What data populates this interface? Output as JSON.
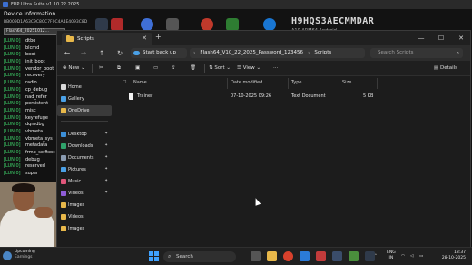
{
  "bgapp": {
    "title": "FRP Ultra Suite v1.10.22.2025",
    "header": "Device Information",
    "serial_label": "BB009D1A63C9C8CC7F0C4A4E4093C8D",
    "serial_value": "Flash64_20251012...",
    "device_name": "H9HQS3AECMMDAR",
    "device_sub": "A10 ARM64 Android",
    "partitions": [
      {
        "tag": "[LUN 0]",
        "name": "dtbo"
      },
      {
        "tag": "[LUN 0]",
        "name": "blcmd"
      },
      {
        "tag": "[LUN 0]",
        "name": "boot"
      },
      {
        "tag": "[LUN 0]",
        "name": "init_boot"
      },
      {
        "tag": "[LUN 0]",
        "name": "vendor_boot"
      },
      {
        "tag": "[LUN 0]",
        "name": "recovery"
      },
      {
        "tag": "[LUN 0]",
        "name": "radio"
      },
      {
        "tag": "[LUN 0]",
        "name": "cp_debug"
      },
      {
        "tag": "[LUN 0]",
        "name": "nad_refer"
      },
      {
        "tag": "[LUN 0]",
        "name": "persistent"
      },
      {
        "tag": "[LUN 0]",
        "name": "misc"
      },
      {
        "tag": "[LUN 0]",
        "name": "keyrefuge"
      },
      {
        "tag": "[LUN 0]",
        "name": "dqmdbg"
      },
      {
        "tag": "[LUN 0]",
        "name": "vbmeta"
      },
      {
        "tag": "[LUN 0]",
        "name": "vbmeta_sys"
      },
      {
        "tag": "[LUN 0]",
        "name": "metadata"
      },
      {
        "tag": "[LUN 0]",
        "name": "frmp_selftest"
      },
      {
        "tag": "[LUN 0]",
        "name": "debug"
      },
      {
        "tag": "[LUN 0]",
        "name": "reserved"
      },
      {
        "tag": "[LUN 0]",
        "name": "super"
      }
    ]
  },
  "explorer": {
    "tab_title": "Scripts",
    "tab_close": "✕",
    "new_tab": "+",
    "win_min": "—",
    "win_max": "☐",
    "win_close": "✕",
    "nav": {
      "back": "←",
      "forward": "→",
      "up": "↑",
      "refresh": "↻"
    },
    "backup_label": "Start back up",
    "breadcrumb": [
      "Flash64_V10_22_2025_Password_123456",
      "Scripts"
    ],
    "search_placeholder": "Search Scripts",
    "toolbar": {
      "new_label": "New",
      "sort_label": "Sort",
      "view_label": "View",
      "more_label": "···",
      "details_label": "Details"
    },
    "sidebar": {
      "home": "Home",
      "gallery": "Gallery",
      "onedrive": "OneDrive",
      "desktop": "Desktop",
      "downloads": "Downloads",
      "documents": "Documents",
      "pictures": "Pictures",
      "music": "Music",
      "videos": "Videos",
      "images": "Images",
      "videos2": "Videos",
      "images2": "Images"
    },
    "columns": {
      "name": "Name",
      "date": "Date modified",
      "type": "Type",
      "size": "Size"
    },
    "files": [
      {
        "name": "Trainer",
        "date": "07-10-2025 09:26",
        "type": "Text Document",
        "size": "5 KB"
      }
    ]
  },
  "taskbar": {
    "weather_title": "Upcoming",
    "weather_sub": "Earnings",
    "search_placeholder": "Search",
    "lang_top": "ENG",
    "lang_bottom": "IN",
    "time": "18:37",
    "date": "28-10-2025"
  },
  "colors": {
    "accent": "#3fa2ff",
    "folder": "#e8b84a",
    "lun_tag": "#3fd46b"
  }
}
